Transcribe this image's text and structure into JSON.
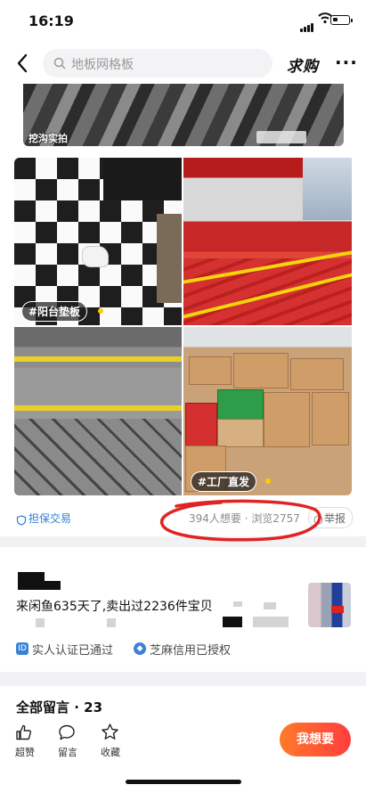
{
  "status_bar": {
    "time": "16:19"
  },
  "nav": {
    "search_placeholder": "地板网格板",
    "qiugou": "求购",
    "more": "···"
  },
  "photos": {
    "top_label": "挖沟实拍",
    "tag_balcony": "#阳台垫板",
    "tag_factory": "#工厂直发"
  },
  "info": {
    "guarantee": "担保交易",
    "stats": "394人想要 · 浏览2757",
    "report": "举报"
  },
  "seller": {
    "summary": "来闲鱼635天了,卖出过2236件宝贝",
    "badges": [
      "实人认证已通过",
      "芝麻信用已授权"
    ]
  },
  "comments": {
    "title": "全部留言 · 23"
  },
  "actions": {
    "like": "超赞",
    "comment": "留言",
    "favorite": "收藏",
    "want": "我想要"
  },
  "colors": {
    "accent_orange": "#ff7a2a",
    "accent_red": "#ff3d3d",
    "link_blue": "#2f7fd9",
    "annotation_red": "#e02424"
  }
}
